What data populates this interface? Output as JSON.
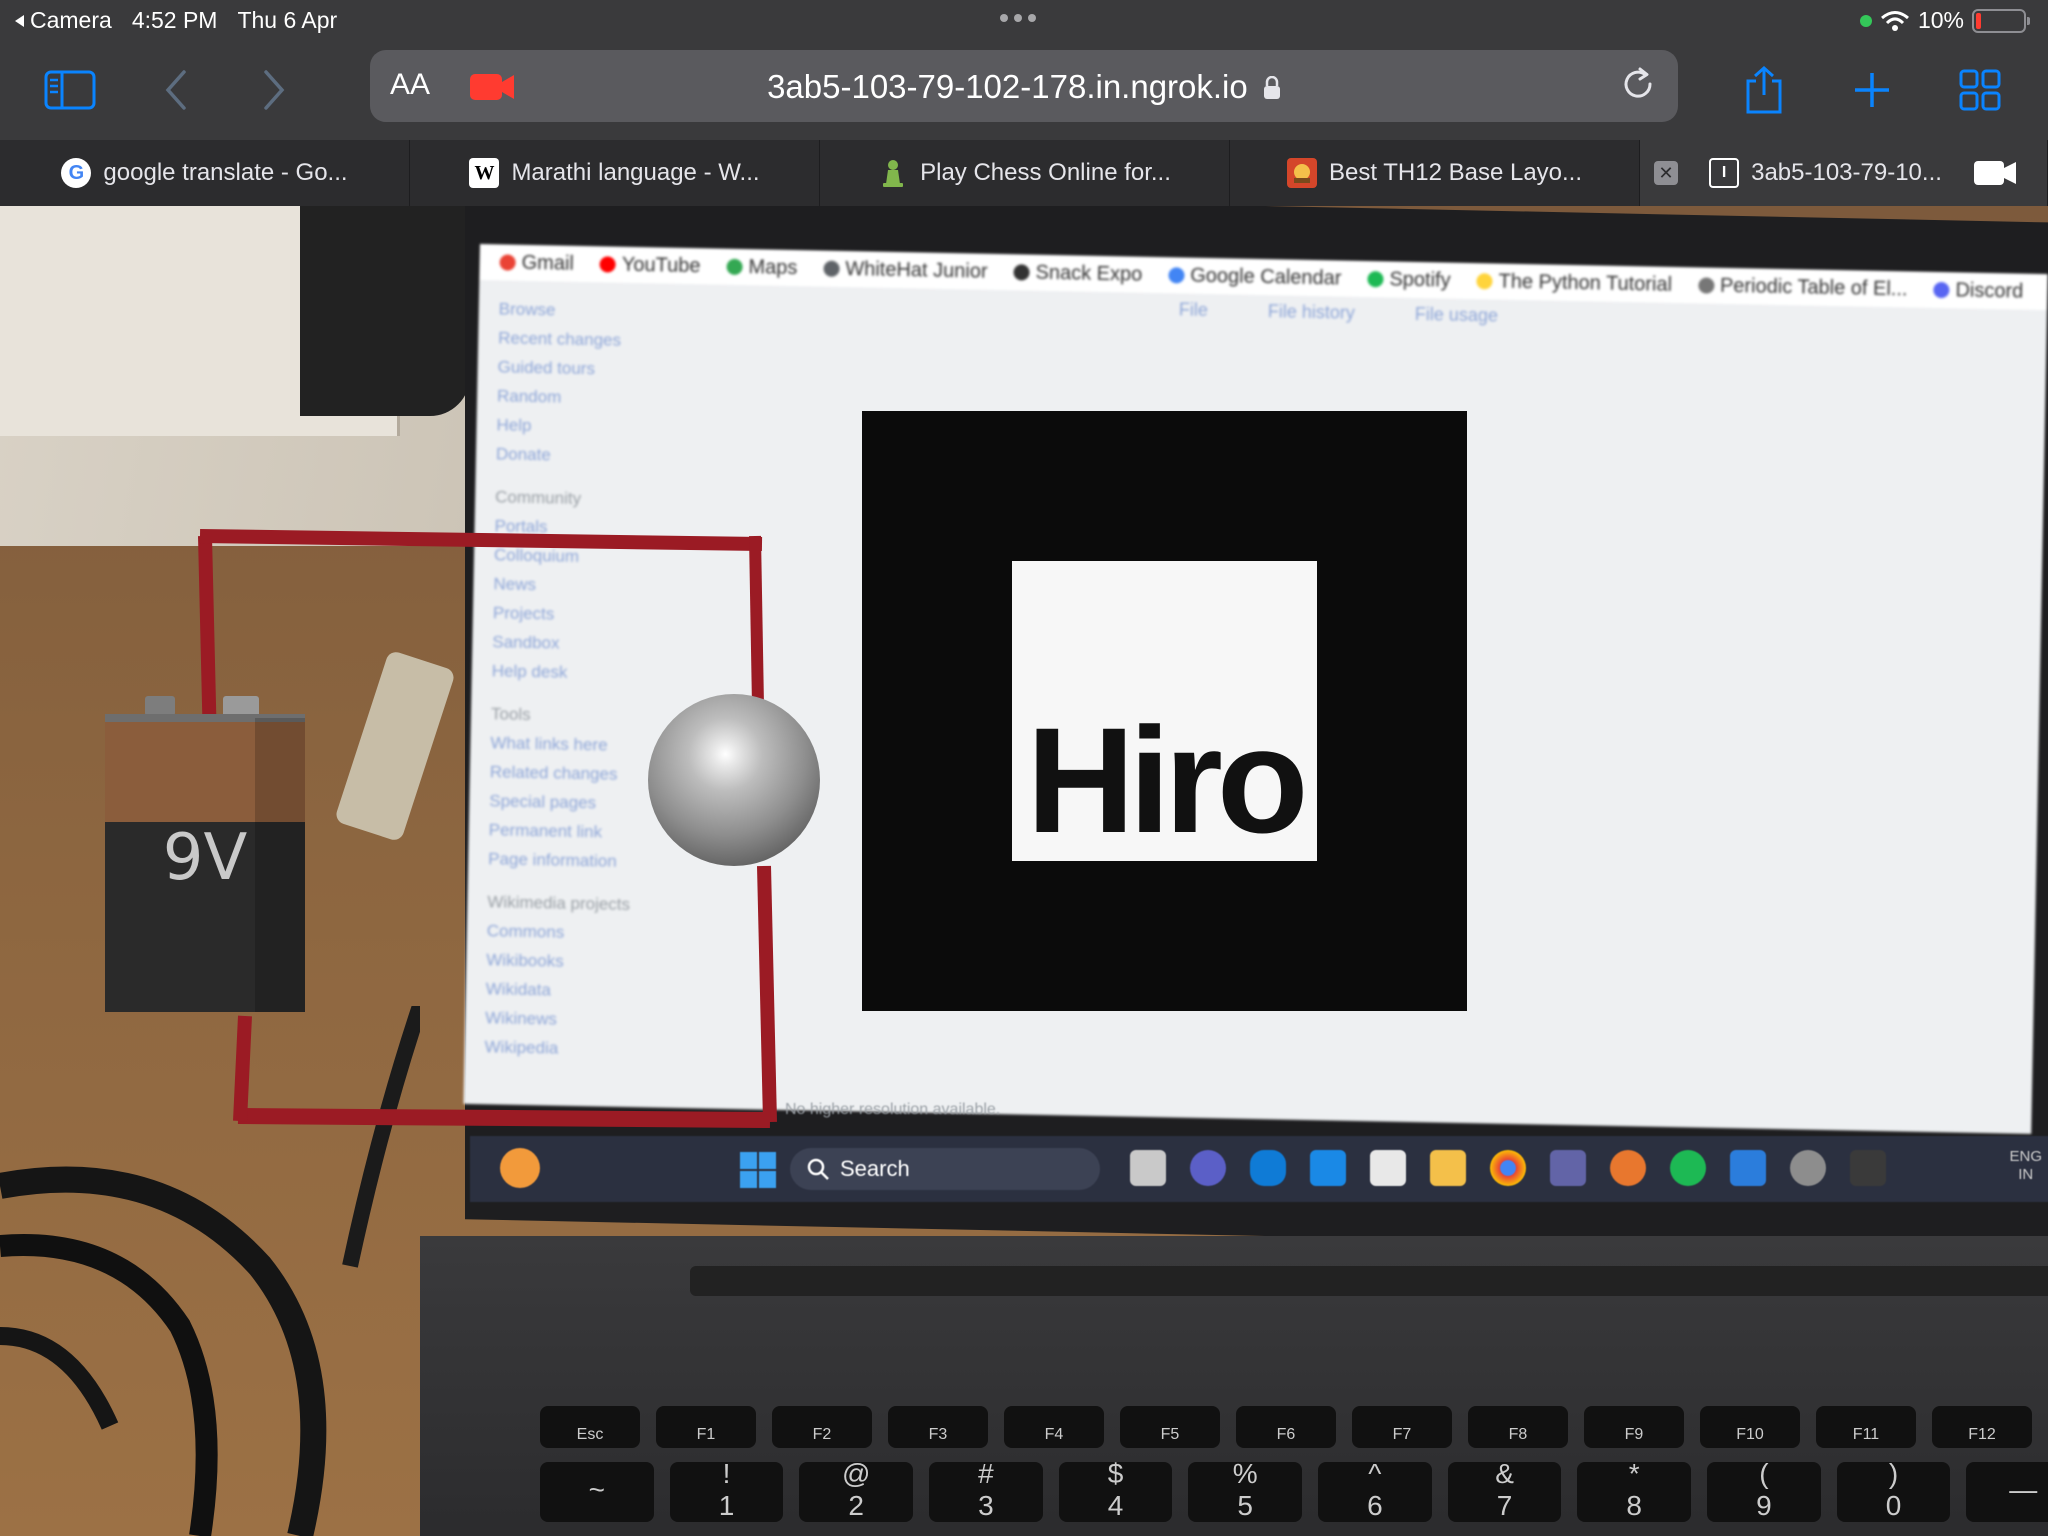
{
  "status_bar": {
    "back_app": "Camera",
    "time": "4:52 PM",
    "date": "Thu 6 Apr",
    "battery_percent": "10%",
    "battery_level": 0.1
  },
  "toolbar": {
    "text_size_label": "AA",
    "url": "3ab5-103-79-102-178.in.ngrok.io"
  },
  "tabs": [
    {
      "title": "google translate - Go...",
      "favicon": "google-icon"
    },
    {
      "title": "Marathi language - W...",
      "favicon": "wikipedia-icon"
    },
    {
      "title": "Play Chess Online for...",
      "favicon": "chess-icon"
    },
    {
      "title": "Best TH12 Base Layo...",
      "favicon": "game-icon"
    },
    {
      "title": "3ab5-103-79-10...",
      "favicon": "page-icon",
      "active": true
    }
  ],
  "scene": {
    "bookmarks": [
      "Gmail",
      "YouTube",
      "Maps",
      "WhiteHat Junior",
      "Snack Expo",
      "Google Calendar",
      "Spotify",
      "The Python Tutorial",
      "Periodic Table of El...",
      "Discord"
    ],
    "wiki_sidebar": {
      "group1": [
        "Browse",
        "Recent changes",
        "Guided tours",
        "Random",
        "Help",
        "Donate"
      ],
      "community_header": "Community",
      "group2": [
        "Portals",
        "Colloquium",
        "News",
        "Projects",
        "Sandbox",
        "Help desk"
      ],
      "tools_header": "Tools",
      "group3": [
        "What links here",
        "Related changes",
        "Special pages",
        "Permanent link",
        "Page information"
      ],
      "projects_header": "Wikimedia projects",
      "group4": [
        "Commons",
        "Wikibooks",
        "Wikidata",
        "Wikinews",
        "Wikipedia"
      ]
    },
    "file_tabs": [
      "File",
      "File history",
      "File usage"
    ],
    "marker_text": "Hiro",
    "no_resolution_text": "No higher resolution available.",
    "taskbar_search": "Search",
    "lang_line1": "ENG",
    "lang_line2": "IN",
    "keys_row1": [
      "Esc",
      "F1",
      "F2",
      "F3",
      "F4",
      "F5",
      "F6",
      "F7",
      "F8",
      "F9",
      "F10",
      "F11",
      "F12"
    ],
    "keys_row2": [
      "~",
      "!",
      "@",
      "#",
      "$",
      "%",
      "^",
      "&",
      "*",
      "(",
      ")",
      "—"
    ],
    "keys_row2_numbers": [
      "",
      "1",
      "2",
      "3",
      "4",
      "5",
      "6",
      "7",
      "8",
      "9",
      "0",
      ""
    ]
  },
  "ar": {
    "battery_label": "9V"
  },
  "colors": {
    "wire": "#9b1b24",
    "toolbar_accent": "#0a84ff",
    "record": "#ff3b30"
  }
}
